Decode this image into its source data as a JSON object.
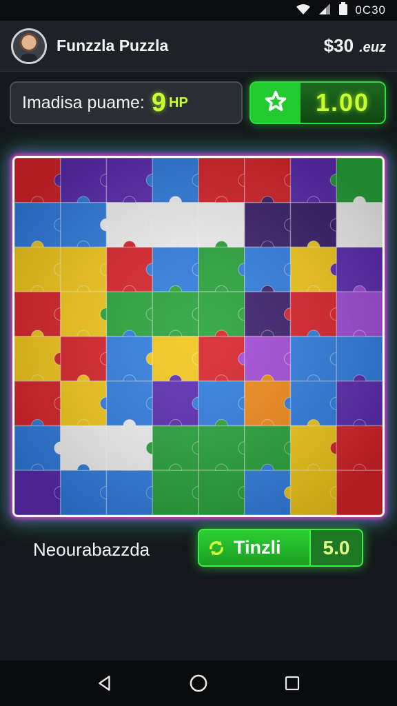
{
  "status_bar": {
    "time": "0C30",
    "icons": [
      "wifi-icon",
      "signal-icon",
      "battery-icon"
    ]
  },
  "header": {
    "title": "Funzzla Puzzla",
    "balance": "$30",
    "balance_unit": ".euz",
    "avatar": "user-avatar"
  },
  "info": {
    "label": "Imadisa puame:",
    "value": "9",
    "unit": "HP"
  },
  "score": {
    "icon": "star-icon",
    "value": "1.00"
  },
  "footer": {
    "status_label": "Neourabazzda",
    "timer_icon": "refresh-icon",
    "timer_label": "Tinzli",
    "timer_value": "5.0"
  },
  "nav": {
    "icons": [
      "back-icon",
      "home-icon",
      "recents-icon"
    ]
  },
  "colors": {
    "accent_green": "#2fe03c",
    "highlight_lime": "#c8ff2e",
    "board_glow": "#ff3cc8"
  }
}
